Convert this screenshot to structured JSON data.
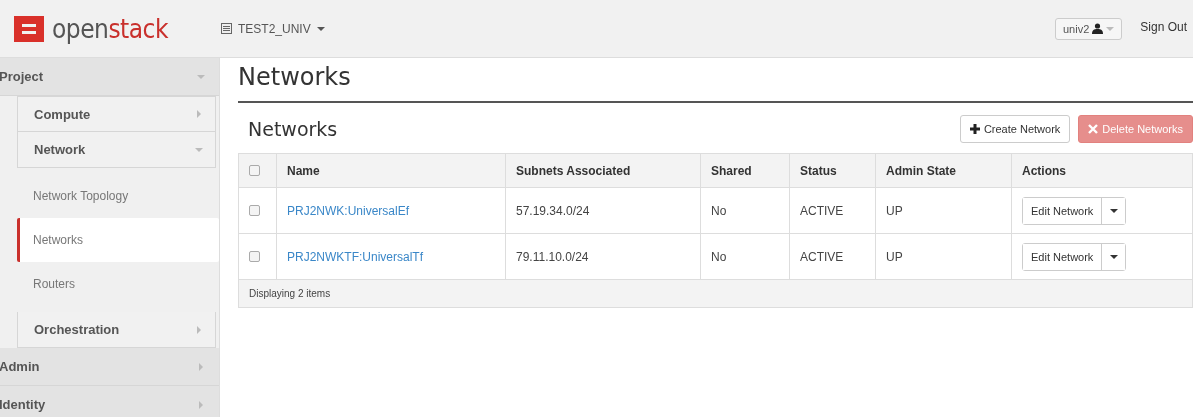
{
  "header": {
    "logo": {
      "prefix": "open",
      "suffix": "stack"
    },
    "project": "TEST2_UNIV",
    "user": "univ2",
    "sign_out": "Sign Out"
  },
  "sidebar": [
    {
      "label": "Project",
      "expanded": true,
      "children": [
        {
          "label": "Compute",
          "expanded": false
        },
        {
          "label": "Network",
          "expanded": true,
          "children": [
            {
              "label": "Network Topology",
              "selected": false
            },
            {
              "label": "Networks",
              "selected": true
            },
            {
              "label": "Routers",
              "selected": false
            }
          ]
        },
        {
          "label": "Orchestration",
          "expanded": false
        }
      ]
    },
    {
      "label": "Admin",
      "expanded": false
    },
    {
      "label": "Identity",
      "expanded": false
    }
  ],
  "page_title": "Networks",
  "table": {
    "title": "Networks",
    "create_button": "Create Network",
    "delete_button": "Delete Networks",
    "delete_disabled": true,
    "select_all_checked": false,
    "columns": [
      "Name",
      "Subnets Associated",
      "Shared",
      "Status",
      "Admin State",
      "Actions"
    ],
    "rows": [
      {
        "checked": false,
        "name": "PRJ2NWK:UniversalEf",
        "subnets": "57.19.34.0/24",
        "shared": "No",
        "status": "ACTIVE",
        "admin_state": "UP",
        "action": "Edit Network"
      },
      {
        "checked": false,
        "name": "PRJ2NWKTF:UniversalTf",
        "subnets": "79.11.10.0/24",
        "shared": "No",
        "status": "ACTIVE",
        "admin_state": "UP",
        "action": "Edit Network"
      }
    ],
    "footer": "Displaying 2 items"
  }
}
